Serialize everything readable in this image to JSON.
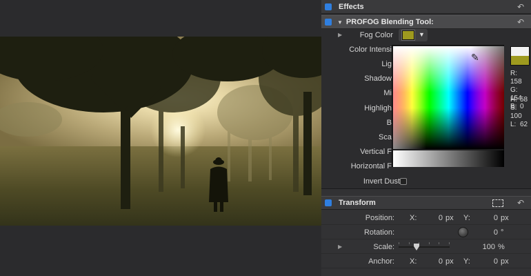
{
  "inspector": {
    "effects_title": "Effects",
    "profog_title": "PROFOG Blending Tool:",
    "reset_glyph": "↶",
    "disclosure_glyph": "▶",
    "expanded_glyph": "▼",
    "dropdown_glyph": "▼",
    "fog_color": {
      "label": "Fog Color",
      "swatch_color": "#9e9a1f"
    },
    "params": [
      "Color Intensi",
      "Lig",
      "Shadow",
      "Mi",
      "Highligh",
      "B",
      "Sca",
      "Vertical F",
      "Horizontal F"
    ],
    "invert_dust_label": "Invert Dust"
  },
  "color_picker": {
    "dropper_glyph": "✎",
    "rgb": [
      {
        "k": "R:",
        "v": "158"
      },
      {
        "k": "G:",
        "v": "154"
      },
      {
        "k": "B:",
        "v": "0"
      }
    ],
    "hsl": [
      {
        "k": "H:",
        "v": "58"
      },
      {
        "k": "S:",
        "v": "100"
      },
      {
        "k": "L:",
        "v": "62"
      }
    ],
    "preview_top": "#f2f2f2",
    "preview_bottom": "#9e9a1f"
  },
  "transform": {
    "title": "Transform",
    "position": {
      "label": "Position:",
      "x_key": "X:",
      "x_val": "0",
      "x_unit": "px",
      "y_key": "Y:",
      "y_val": "0",
      "y_unit": "px"
    },
    "rotation": {
      "label": "Rotation:",
      "val": "0",
      "unit": "°"
    },
    "scale": {
      "label": "Scale:",
      "val": "100",
      "unit": "%"
    },
    "anchor": {
      "label": "Anchor:",
      "x_key": "X:",
      "x_val": "0",
      "x_unit": "px",
      "y_key": "Y:",
      "y_val": "0",
      "y_unit": "px"
    }
  }
}
